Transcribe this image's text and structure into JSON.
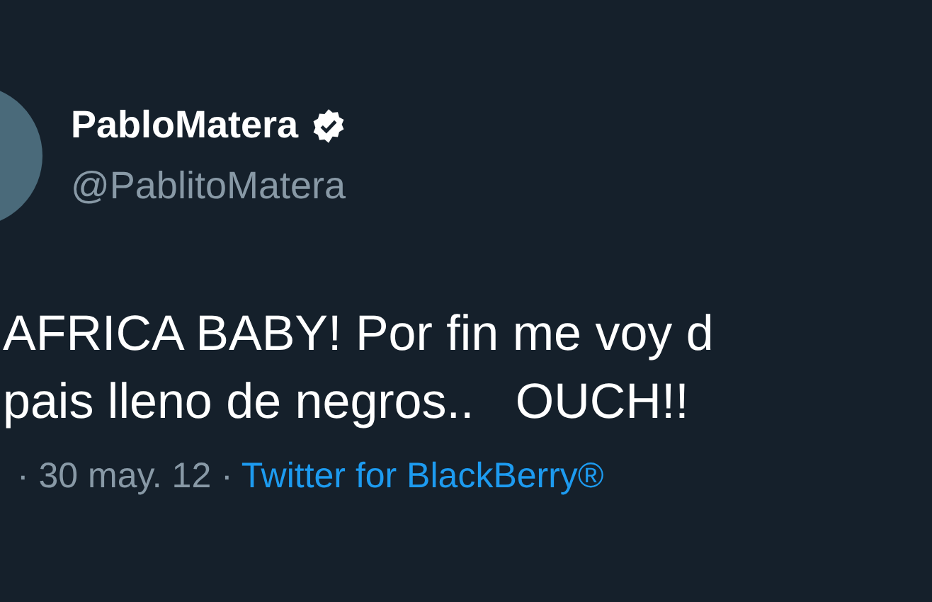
{
  "tweet": {
    "display_name": "PabloMatera",
    "verified": true,
    "handle": "@PablitoMatera",
    "text_lines": [
      "AFRICA BABY! Por fin me voy d",
      "pais lleno de negros..   OUCH!!"
    ],
    "date": "· 30 may. 12 ·",
    "source": "Twitter for BlackBerry®"
  }
}
